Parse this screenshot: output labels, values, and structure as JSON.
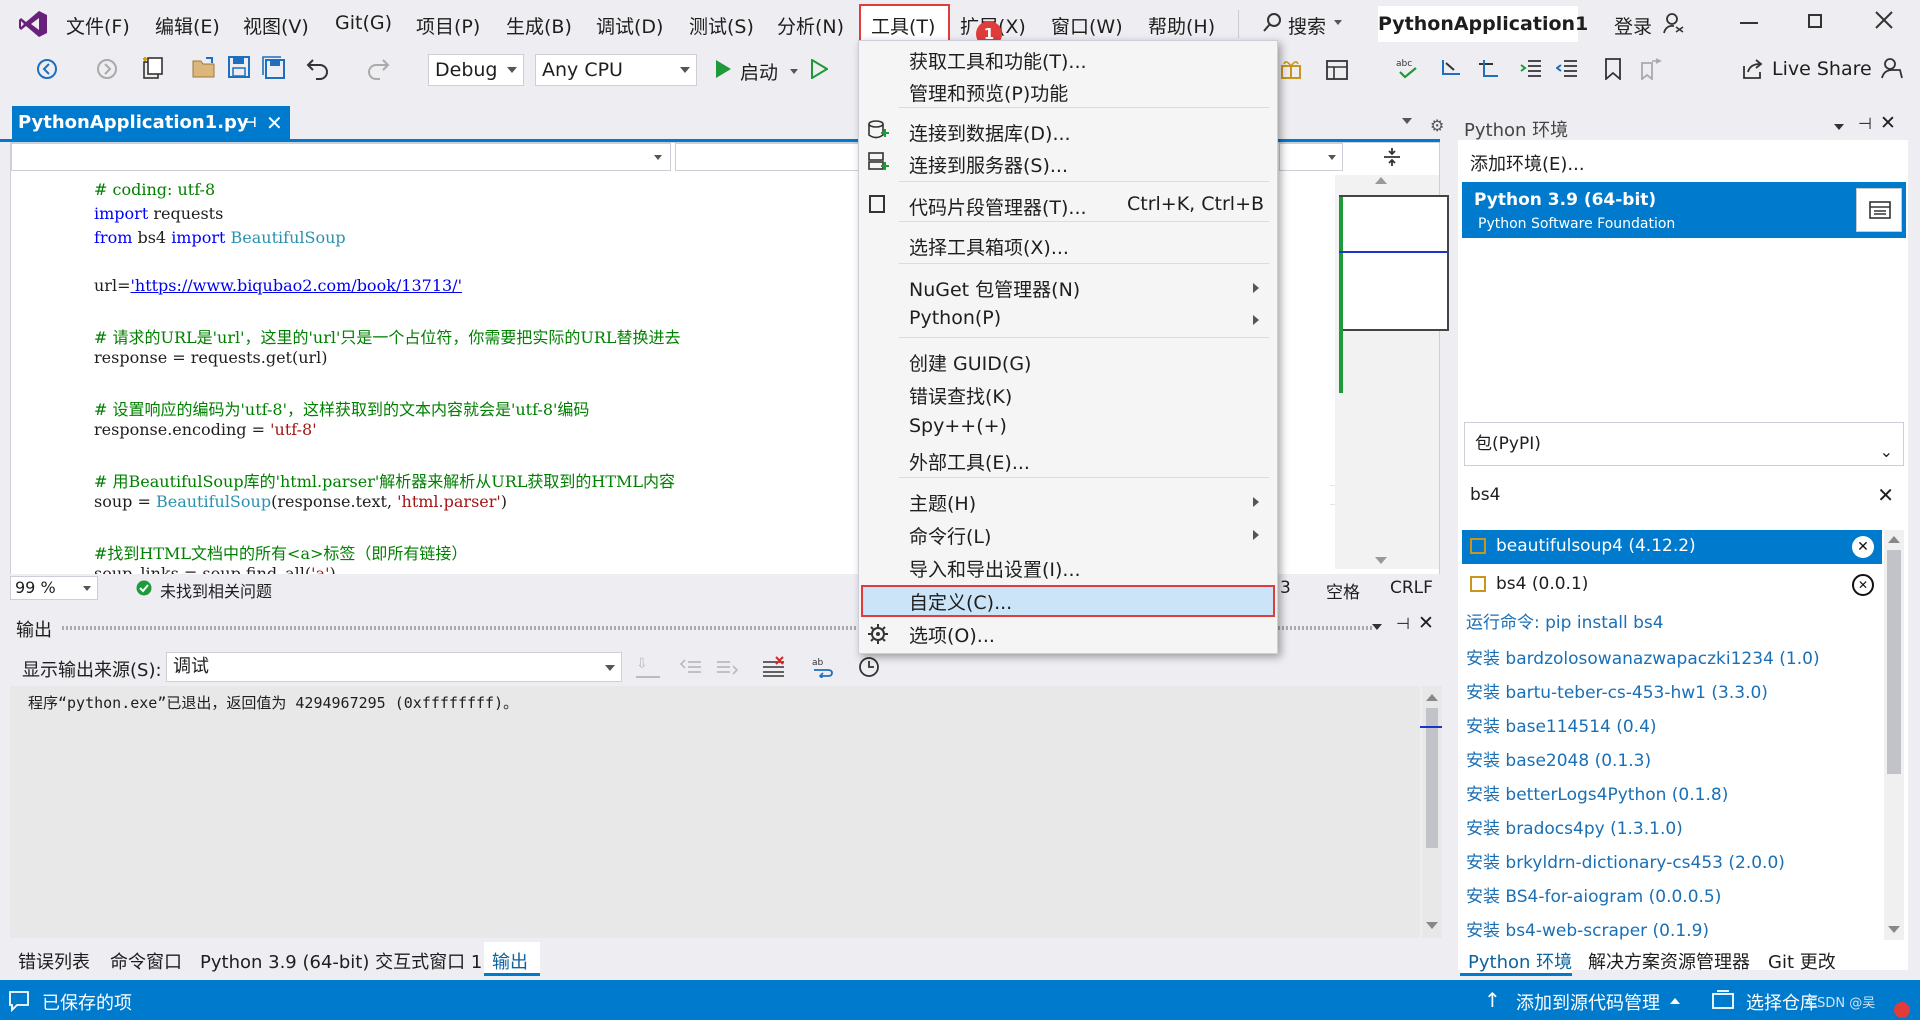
{
  "colors": {
    "accent": "#007acc",
    "highlight": "#e03c3c",
    "menu_hover": "#cce4f7"
  },
  "menubar": {
    "items": [
      "文件(F)",
      "编辑(E)",
      "视图(V)",
      "Git(G)",
      "项目(P)",
      "生成(B)",
      "调试(D)",
      "测试(S)",
      "分析(N)",
      "工具(T)",
      "扩展(X)",
      "窗口(W)",
      "帮助(H)"
    ],
    "search": "搜索",
    "title": "PythonApplication1",
    "login": "登录",
    "badge": "1"
  },
  "toolbar": {
    "config": "Debug",
    "platform": "Any CPU",
    "start": "启动",
    "live_share": "Live Share"
  },
  "editor": {
    "tab_title": "PythonApplication1.py",
    "code": [
      "# coding: utf-8",
      "import requests",
      "from bs4 import BeautifulSoup",
      "",
      "url='https://www.biqubao2.com/book/13713/'",
      "",
      "# 请求的URL是'url'，这里的'url'只是一个占位符，你需要把实际的URL替换进去",
      "response = requests.get(url)",
      "",
      "# 设置响应的编码为'utf-8'，这样获取到的文本内容就会是'utf-8'编码",
      "response.encoding = 'utf-8'",
      "",
      "# 用BeautifulSoup库的'html.parser'解析器来解析从URL获取到的HTML内容",
      "soup = BeautifulSoup(response.text, 'html.parser')",
      "",
      "#找到HTML文档中的所有<a>标签（即所有链接）",
      "soup_links = soup.find_all('a')"
    ],
    "zoom": "99 %",
    "issues": "未找到相关问题",
    "col": "3",
    "spaces": "空格",
    "eol": "CRLF"
  },
  "output": {
    "title": "输出",
    "source_label": "显示输出来源(S):",
    "source_value": "调试",
    "text": "程序“python.exe”已退出，返回值为 4294967295 (0xffffffff)。"
  },
  "bottom_tabs": [
    "错误列表",
    "命令窗口",
    "Python 3.9 (64-bit) 交互式窗口 1",
    "输出"
  ],
  "python_env": {
    "title": "Python 环境",
    "add_env": "添加环境(E)...",
    "env_name": "Python 3.9 (64-bit)",
    "env_vendor": "Python Software Foundation",
    "pkg_source": "包(PyPI)",
    "search_value": "bs4",
    "installed": [
      "beautifulsoup4 (4.12.2)",
      "bs4 (0.0.1)"
    ],
    "run_cmd": "运行命令: pip install bs4",
    "results": [
      "安装 bardzolosowanazwapaczki1234 (1.0)",
      "安装 bartu-teber-cs-453-hw1 (3.3.0)",
      "安装 base114514 (0.4)",
      "安装 base2048 (0.1.3)",
      "安装 betterLogs4Python (0.1.8)",
      "安装 bradocs4py (1.3.1.0)",
      "安装 brkyldrn-dictionary-cs453 (2.0.0)",
      "安装 BS4-for-aiogram (0.0.0.5)",
      "安装 bs4-web-scraper (0.1.9)"
    ],
    "tabs": [
      "Python 环境",
      "解决方案资源管理器",
      "Git 更改"
    ]
  },
  "statusbar": {
    "saved": "已保存的项",
    "add_source": "添加到源代码管理",
    "select_repo": "选择仓库",
    "watermark": "CSDN @吴"
  },
  "tools_menu": {
    "items": [
      {
        "label": "获取工具和功能(T)...",
        "shortcut": ""
      },
      {
        "label": "管理和预览(P)功能",
        "shortcut": ""
      },
      {
        "label": "连接到数据库(D)...",
        "shortcut": ""
      },
      {
        "label": "连接到服务器(S)...",
        "shortcut": ""
      },
      {
        "label": "代码片段管理器(T)...",
        "shortcut": "Ctrl+K, Ctrl+B"
      },
      {
        "label": "选择工具箱项(X)...",
        "shortcut": ""
      },
      {
        "label": "NuGet 包管理器(N)",
        "shortcut": ""
      },
      {
        "label": "Python(P)",
        "shortcut": ""
      },
      {
        "label": "创建 GUID(G)",
        "shortcut": ""
      },
      {
        "label": "错误查找(K)",
        "shortcut": ""
      },
      {
        "label": "Spy++(+)",
        "shortcut": ""
      },
      {
        "label": "外部工具(E)...",
        "shortcut": ""
      },
      {
        "label": "主题(H)",
        "shortcut": ""
      },
      {
        "label": "命令行(L)",
        "shortcut": ""
      },
      {
        "label": "导入和导出设置(I)...",
        "shortcut": ""
      },
      {
        "label": "自定义(C)...",
        "shortcut": ""
      },
      {
        "label": "选项(O)...",
        "shortcut": ""
      }
    ]
  }
}
